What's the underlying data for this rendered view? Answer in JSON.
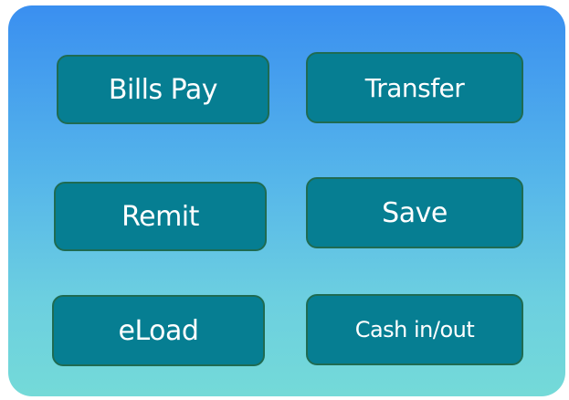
{
  "colors": {
    "panel_top": "#3a8ff0",
    "panel_bottom": "#74dad8",
    "button_fill": "#067e92",
    "button_border": "#1f6b52",
    "button_text": "#ffffff"
  },
  "buttons": [
    {
      "label": "Bills Pay"
    },
    {
      "label": "Transfer"
    },
    {
      "label": "Remit"
    },
    {
      "label": "Save"
    },
    {
      "label": "eLoad"
    },
    {
      "label": "Cash in/out"
    }
  ]
}
